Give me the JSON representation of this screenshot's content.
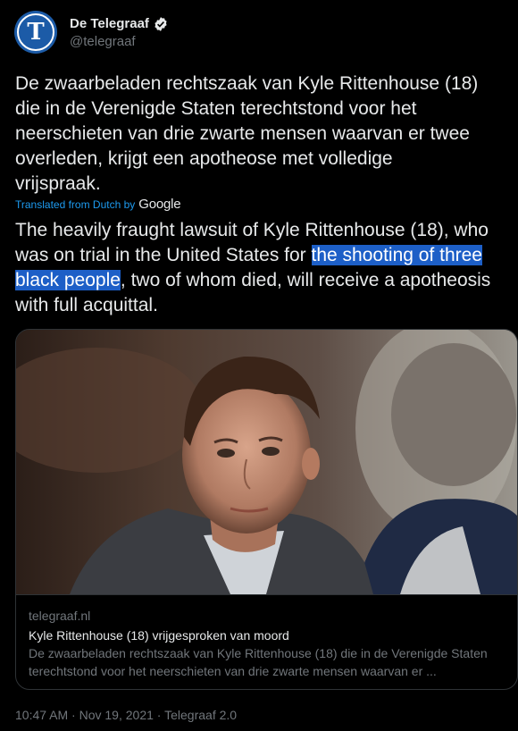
{
  "author": {
    "display_name": "De Telegraaf",
    "handle": "@telegraaf",
    "avatar_letter": "T",
    "verified": true
  },
  "tweet": {
    "original_text": "De zwaarbeladen rechtszaak van Kyle Rittenhouse (18)\ndie in de Verenigde Staten terechtstond voor het\nneerschieten van drie zwarte mensen waarvan er twee\noverleden, krijgt een apotheose met volledige\nvrijspraak.",
    "translated_from": "Translated from Dutch by",
    "translator": "Google",
    "translation_before": "The heavily fraught lawsuit of Kyle Rittenhouse (18), who was on trial in the United States for ",
    "translation_highlight": "the shooting of three black people",
    "translation_after": ", two of whom died, will receive a apotheosis with full acquittal."
  },
  "card": {
    "domain": "telegraaf.nl",
    "title": "Kyle Rittenhouse (18) vrijgesproken van moord",
    "description": "De zwaarbeladen rechtszaak van Kyle Rittenhouse (18) die in de Verenigde Staten terechtstond voor het neerschieten van drie zwarte mensen waarvan er ..."
  },
  "meta": {
    "time": "10:47 AM",
    "sep1": " · ",
    "date": "Nov 19, 2021",
    "sep2": " · ",
    "source": "Telegraaf 2.0"
  },
  "colors": {
    "background": "#000000",
    "accent": "#1d9bf0",
    "highlight": "#1d5fc7",
    "muted": "#71767b",
    "text": "#e7e9ea"
  }
}
